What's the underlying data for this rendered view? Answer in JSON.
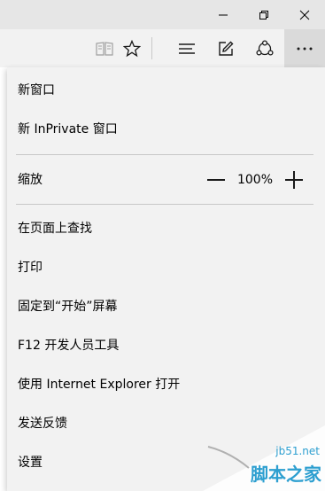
{
  "menu": {
    "new_window": "新窗口",
    "new_inprivate": "新 InPrivate 窗口",
    "zoom_label": "缩放",
    "zoom_value": "100%",
    "find_on_page": "在页面上查找",
    "print": "打印",
    "pin_to_start": "固定到“开始”屏幕",
    "f12_tools": "F12 开发人员工具",
    "open_with_ie": "使用 Internet Explorer 打开",
    "send_feedback": "发送反馈",
    "settings": "设置"
  },
  "icons": {
    "minimize": "minimize-icon",
    "restore": "restore-icon",
    "close": "close-icon",
    "reading_view": "reading-view-icon",
    "favorite": "star-icon",
    "hub": "hub-icon",
    "web_note": "web-note-icon",
    "share": "share-icon",
    "more": "more-icon"
  },
  "watermark": {
    "site": "jb51.net",
    "name": "脚本之家"
  },
  "colors": {
    "menu_bg": "#f2f2f2",
    "titlebar_bg": "#e6e6e6",
    "active_button_bg": "#dadada",
    "separator": "#c8c8c8",
    "watermark": "#2d9fd0"
  }
}
